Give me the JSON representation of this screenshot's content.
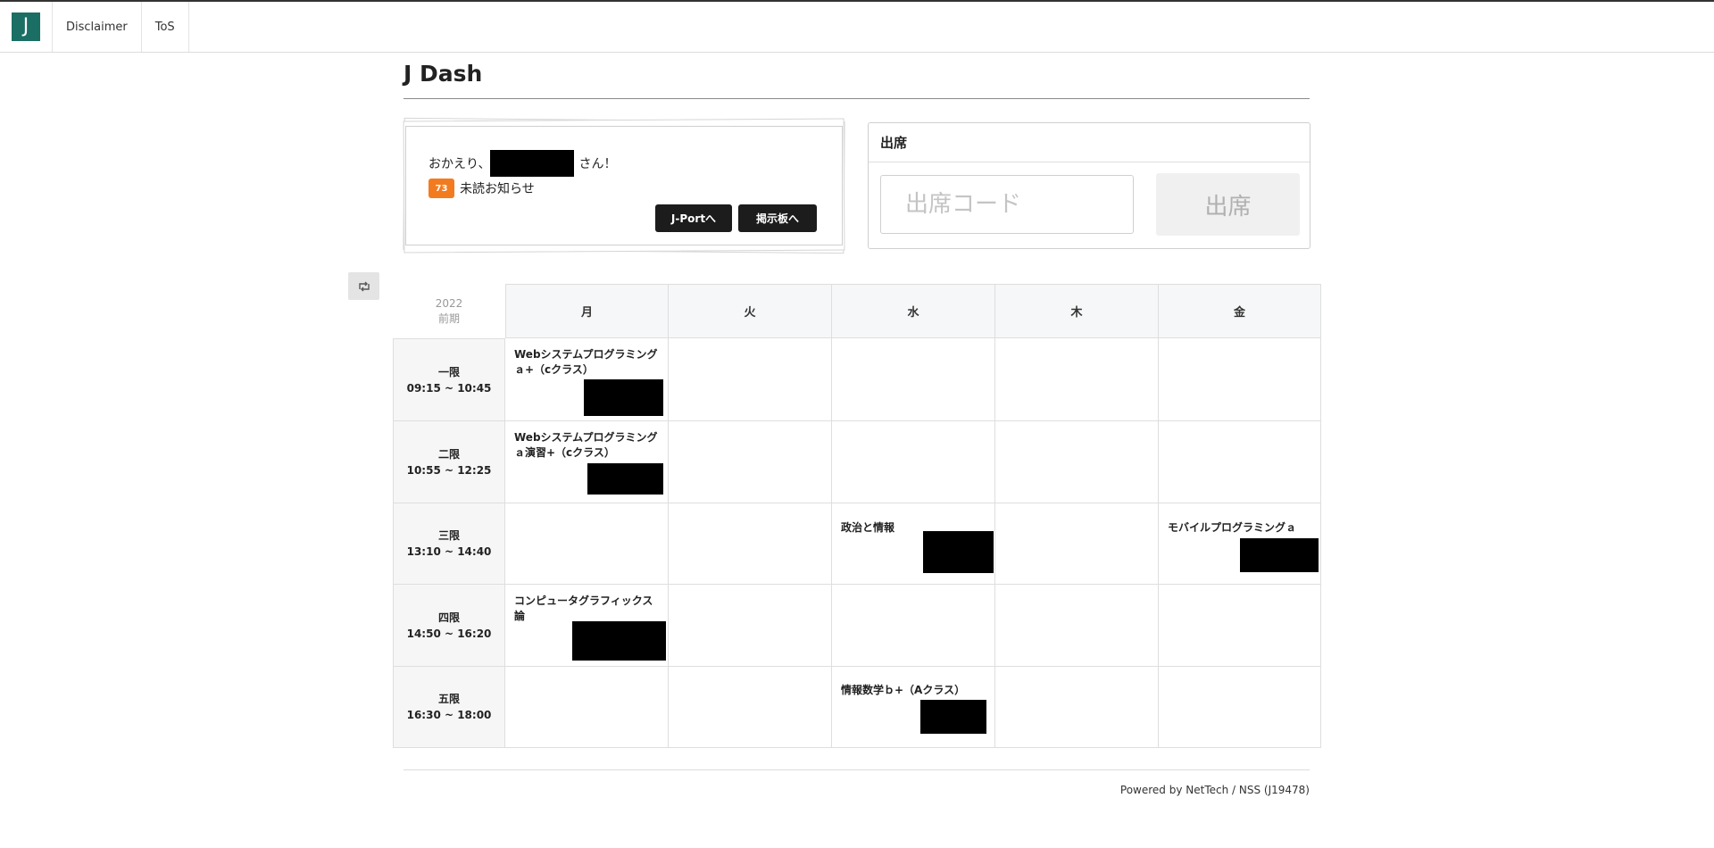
{
  "nav": {
    "logo_letter": "J",
    "items": [
      "Disclaimer",
      "ToS"
    ]
  },
  "page_title": "J Dash",
  "welcome": {
    "prefix": "おかえり、",
    "suffix": "さん！",
    "unread_count": "73",
    "unread_label": "未読お知らせ",
    "btn_jport": "J-Portへ",
    "btn_board": "掲示板へ"
  },
  "attendance": {
    "title": "出席",
    "placeholder": "出席コード",
    "button": "出席"
  },
  "timetable": {
    "year": "2022",
    "term": "前期",
    "days": [
      "月",
      "火",
      "水",
      "木",
      "金"
    ],
    "periods": [
      {
        "name": "一限",
        "time": "09:15 ~ 10:45"
      },
      {
        "name": "二限",
        "time": "10:55 ~ 12:25"
      },
      {
        "name": "三限",
        "time": "13:10 ~ 14:40"
      },
      {
        "name": "四限",
        "time": "14:50 ~ 16:20"
      },
      {
        "name": "五限",
        "time": "16:30 ~ 18:00"
      }
    ],
    "courses": {
      "mon1": "Webシステムプログラミングａ+（cクラス）",
      "mon2": "Webシステムプログラミングａ演習+（cクラス）",
      "wed3": "政治と情報",
      "fri3": "モバイルプログラミングａ",
      "mon4": "コンピュータグラフィックス論",
      "wed5": "情報数学ｂ+（Aクラス）"
    }
  },
  "footer": "Powered by NetTech / NSS (J19478)",
  "colors": {
    "logo_bg": "#1a6e63",
    "badge": "#f27b1f",
    "button_dark": "#1c1c1c"
  }
}
